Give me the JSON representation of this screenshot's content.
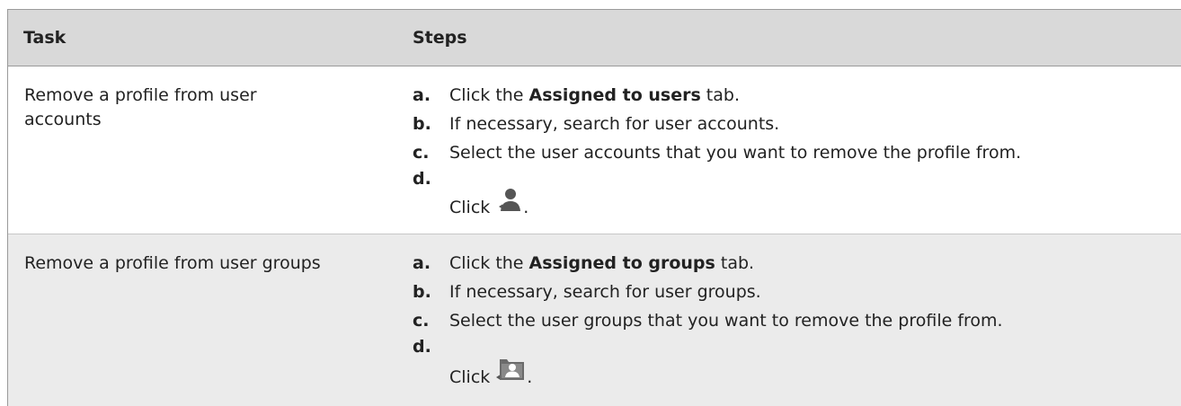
{
  "header": {
    "task": "Task",
    "steps": "Steps"
  },
  "rows": [
    {
      "task": "Remove a profile from user accounts",
      "steps": [
        {
          "letter": "a.",
          "pre": "Click the ",
          "bold": "Assigned to users",
          "post": " tab."
        },
        {
          "letter": "b.",
          "pre": "If necessary, search for user accounts.",
          "bold": "",
          "post": ""
        },
        {
          "letter": "c.",
          "pre": "Select the user accounts that you want to remove the profile from.",
          "bold": "",
          "post": ""
        },
        {
          "letter": "d.",
          "pre": "Click ",
          "bold": "",
          "post": ".",
          "icon": "remove-user-icon"
        }
      ]
    },
    {
      "task": "Remove a profile from user groups",
      "steps": [
        {
          "letter": "a.",
          "pre": "Click the ",
          "bold": "Assigned to groups",
          "post": " tab."
        },
        {
          "letter": "b.",
          "pre": "If necessary, search for user groups.",
          "bold": "",
          "post": ""
        },
        {
          "letter": "c.",
          "pre": "Select the user groups that you want to remove the profile from.",
          "bold": "",
          "post": ""
        },
        {
          "letter": "d.",
          "pre": "Click ",
          "bold": "",
          "post": ".",
          "icon": "remove-group-icon"
        }
      ]
    }
  ],
  "colors": {
    "header_bg": "#d9d9d9",
    "alt_row_bg": "#ebebeb",
    "icon_gray": "#555555"
  }
}
